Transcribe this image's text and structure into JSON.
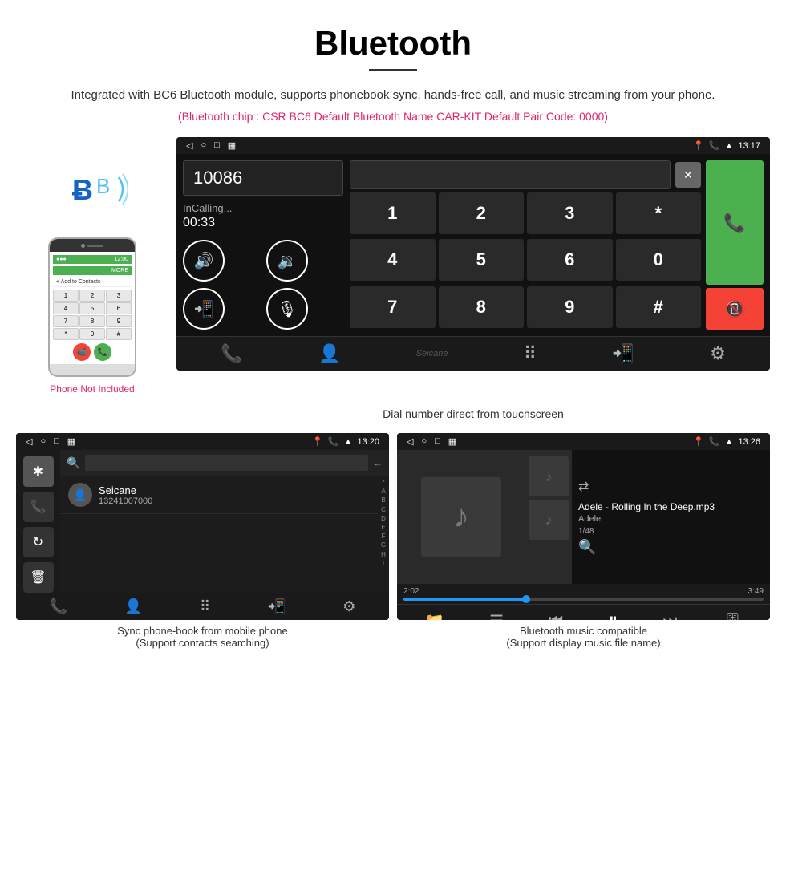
{
  "page": {
    "title": "Bluetooth",
    "subtitle": "Integrated with BC6 Bluetooth module, supports phonebook sync, hands-free call, and music streaming from your phone.",
    "specs": "(Bluetooth chip : CSR BC6    Default Bluetooth Name CAR-KIT    Default Pair Code: 0000)"
  },
  "phone_side": {
    "not_included": "Phone Not Included"
  },
  "main_screen": {
    "status_bar": {
      "nav_icons": "◁  ○  □  ▦",
      "time": "13:17",
      "right_icons": "📍 📞 ▲"
    },
    "dial_number": "10086",
    "status": "InCalling...",
    "timer": "00:33",
    "numpad": [
      "1",
      "2",
      "3",
      "*",
      "4",
      "5",
      "6",
      "0",
      "7",
      "8",
      "9",
      "#"
    ],
    "watermark": "Seicane"
  },
  "main_caption": "Dial number direct from touchscreen",
  "phonebook_screen": {
    "status_bar_time": "13:20",
    "contact_name": "Seicane",
    "contact_phone": "13241007000",
    "alphabet": [
      "*",
      "A",
      "B",
      "C",
      "D",
      "E",
      "F",
      "G",
      "H",
      "I"
    ]
  },
  "phonebook_caption_line1": "Sync phone-book from mobile phone",
  "phonebook_caption_line2": "(Support contacts searching)",
  "music_screen": {
    "status_bar_time": "13:26",
    "track_name": "Adele - Rolling In the Deep.mp3",
    "artist": "Adele",
    "progress": "1/48",
    "time_current": "2:02",
    "time_total": "3:49",
    "progress_percent": 34
  },
  "music_caption_line1": "Bluetooth music compatible",
  "music_caption_line2": "(Support display music file name)"
}
